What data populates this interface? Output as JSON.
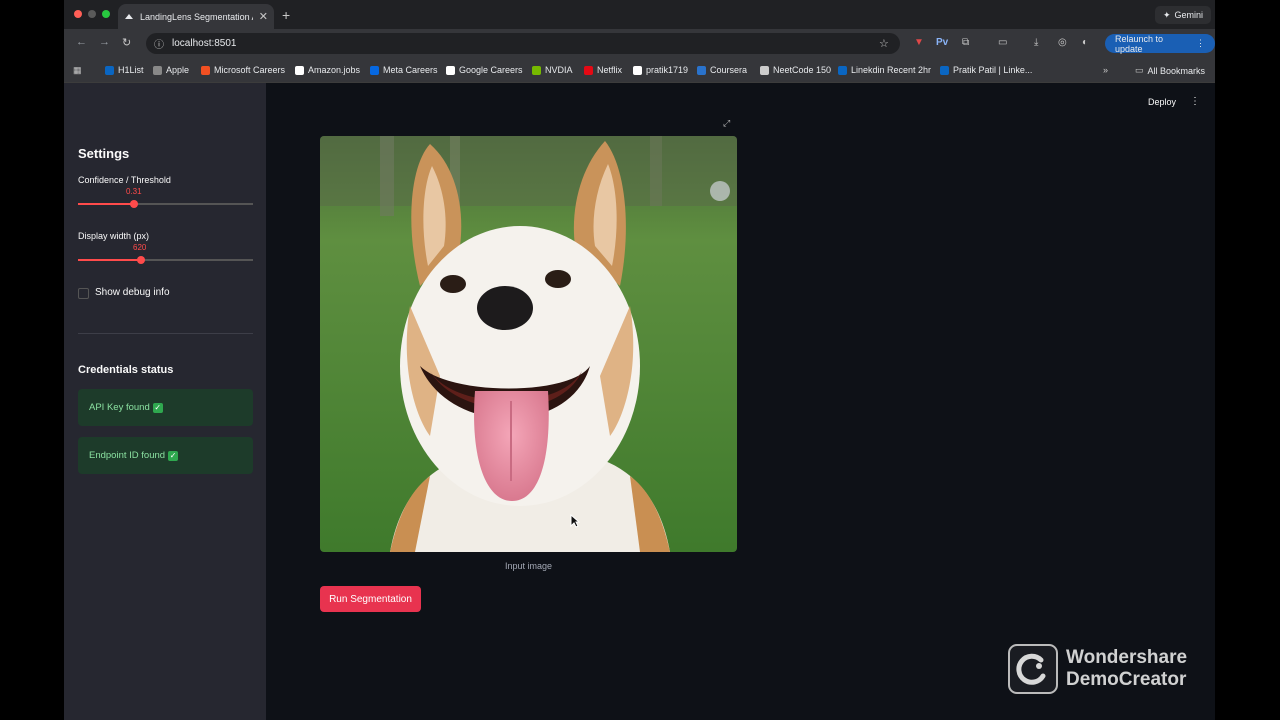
{
  "browser": {
    "tab_title": "LandingLens Segmentation A",
    "url": "localhost:8501",
    "gemini_label": "Gemini",
    "relaunch_label": "Relaunch to update",
    "ext_pv": "Pv"
  },
  "bookmarks": [
    {
      "label": "H1List",
      "icon": "linkedin-icon",
      "color": "#0a66c2"
    },
    {
      "label": "Apple",
      "icon": "apple-icon",
      "color": "#888888"
    },
    {
      "label": "Microsoft Careers",
      "icon": "microsoft-icon",
      "color": "#f25022"
    },
    {
      "label": "Amazon.jobs",
      "icon": "amazon-icon",
      "color": "#ffffff"
    },
    {
      "label": "Meta Careers",
      "icon": "meta-icon",
      "color": "#0668e1"
    },
    {
      "label": "Google Careers",
      "icon": "google-icon",
      "color": "#ffffff"
    },
    {
      "label": "NVDIA",
      "icon": "nvidia-icon",
      "color": "#76b900"
    },
    {
      "label": "Netflix",
      "icon": "netflix-icon",
      "color": "#e50914"
    },
    {
      "label": "pratik1719",
      "icon": "github-icon",
      "color": "#ffffff"
    },
    {
      "label": "Coursera",
      "icon": "coursera-icon",
      "color": "#2a73cc"
    },
    {
      "label": "NeetCode 150",
      "icon": "neetcode-icon",
      "color": "#cccccc"
    },
    {
      "label": "Linekdin Recent 2hr",
      "icon": "linkedin-icon",
      "color": "#0a66c2"
    },
    {
      "label": "Pratik Patil | Linke...",
      "icon": "linkedin-icon",
      "color": "#0a66c2"
    }
  ],
  "all_bookmarks_label": "All Bookmarks",
  "sidebar": {
    "title": "Settings",
    "confidence_label": "Confidence / Threshold",
    "confidence_value": "0.31",
    "confidence_fraction": 0.32,
    "width_label": "Display width (px)",
    "width_value": "620",
    "width_fraction": 0.36,
    "debug_label": "Show debug info",
    "credentials_title": "Credentials status",
    "api_key_status": "API Key found",
    "endpoint_status": "Endpoint ID found"
  },
  "header": {
    "deploy_label": "Deploy"
  },
  "main": {
    "image_caption": "Input image",
    "run_button": "Run Segmentation"
  },
  "watermark": {
    "line1": "Wondershare",
    "line2": "DemoCreator"
  },
  "colors": {
    "accent": "#ff4b4b",
    "success_bg": "#1d3b2a",
    "success_text": "#8ae0a0"
  }
}
